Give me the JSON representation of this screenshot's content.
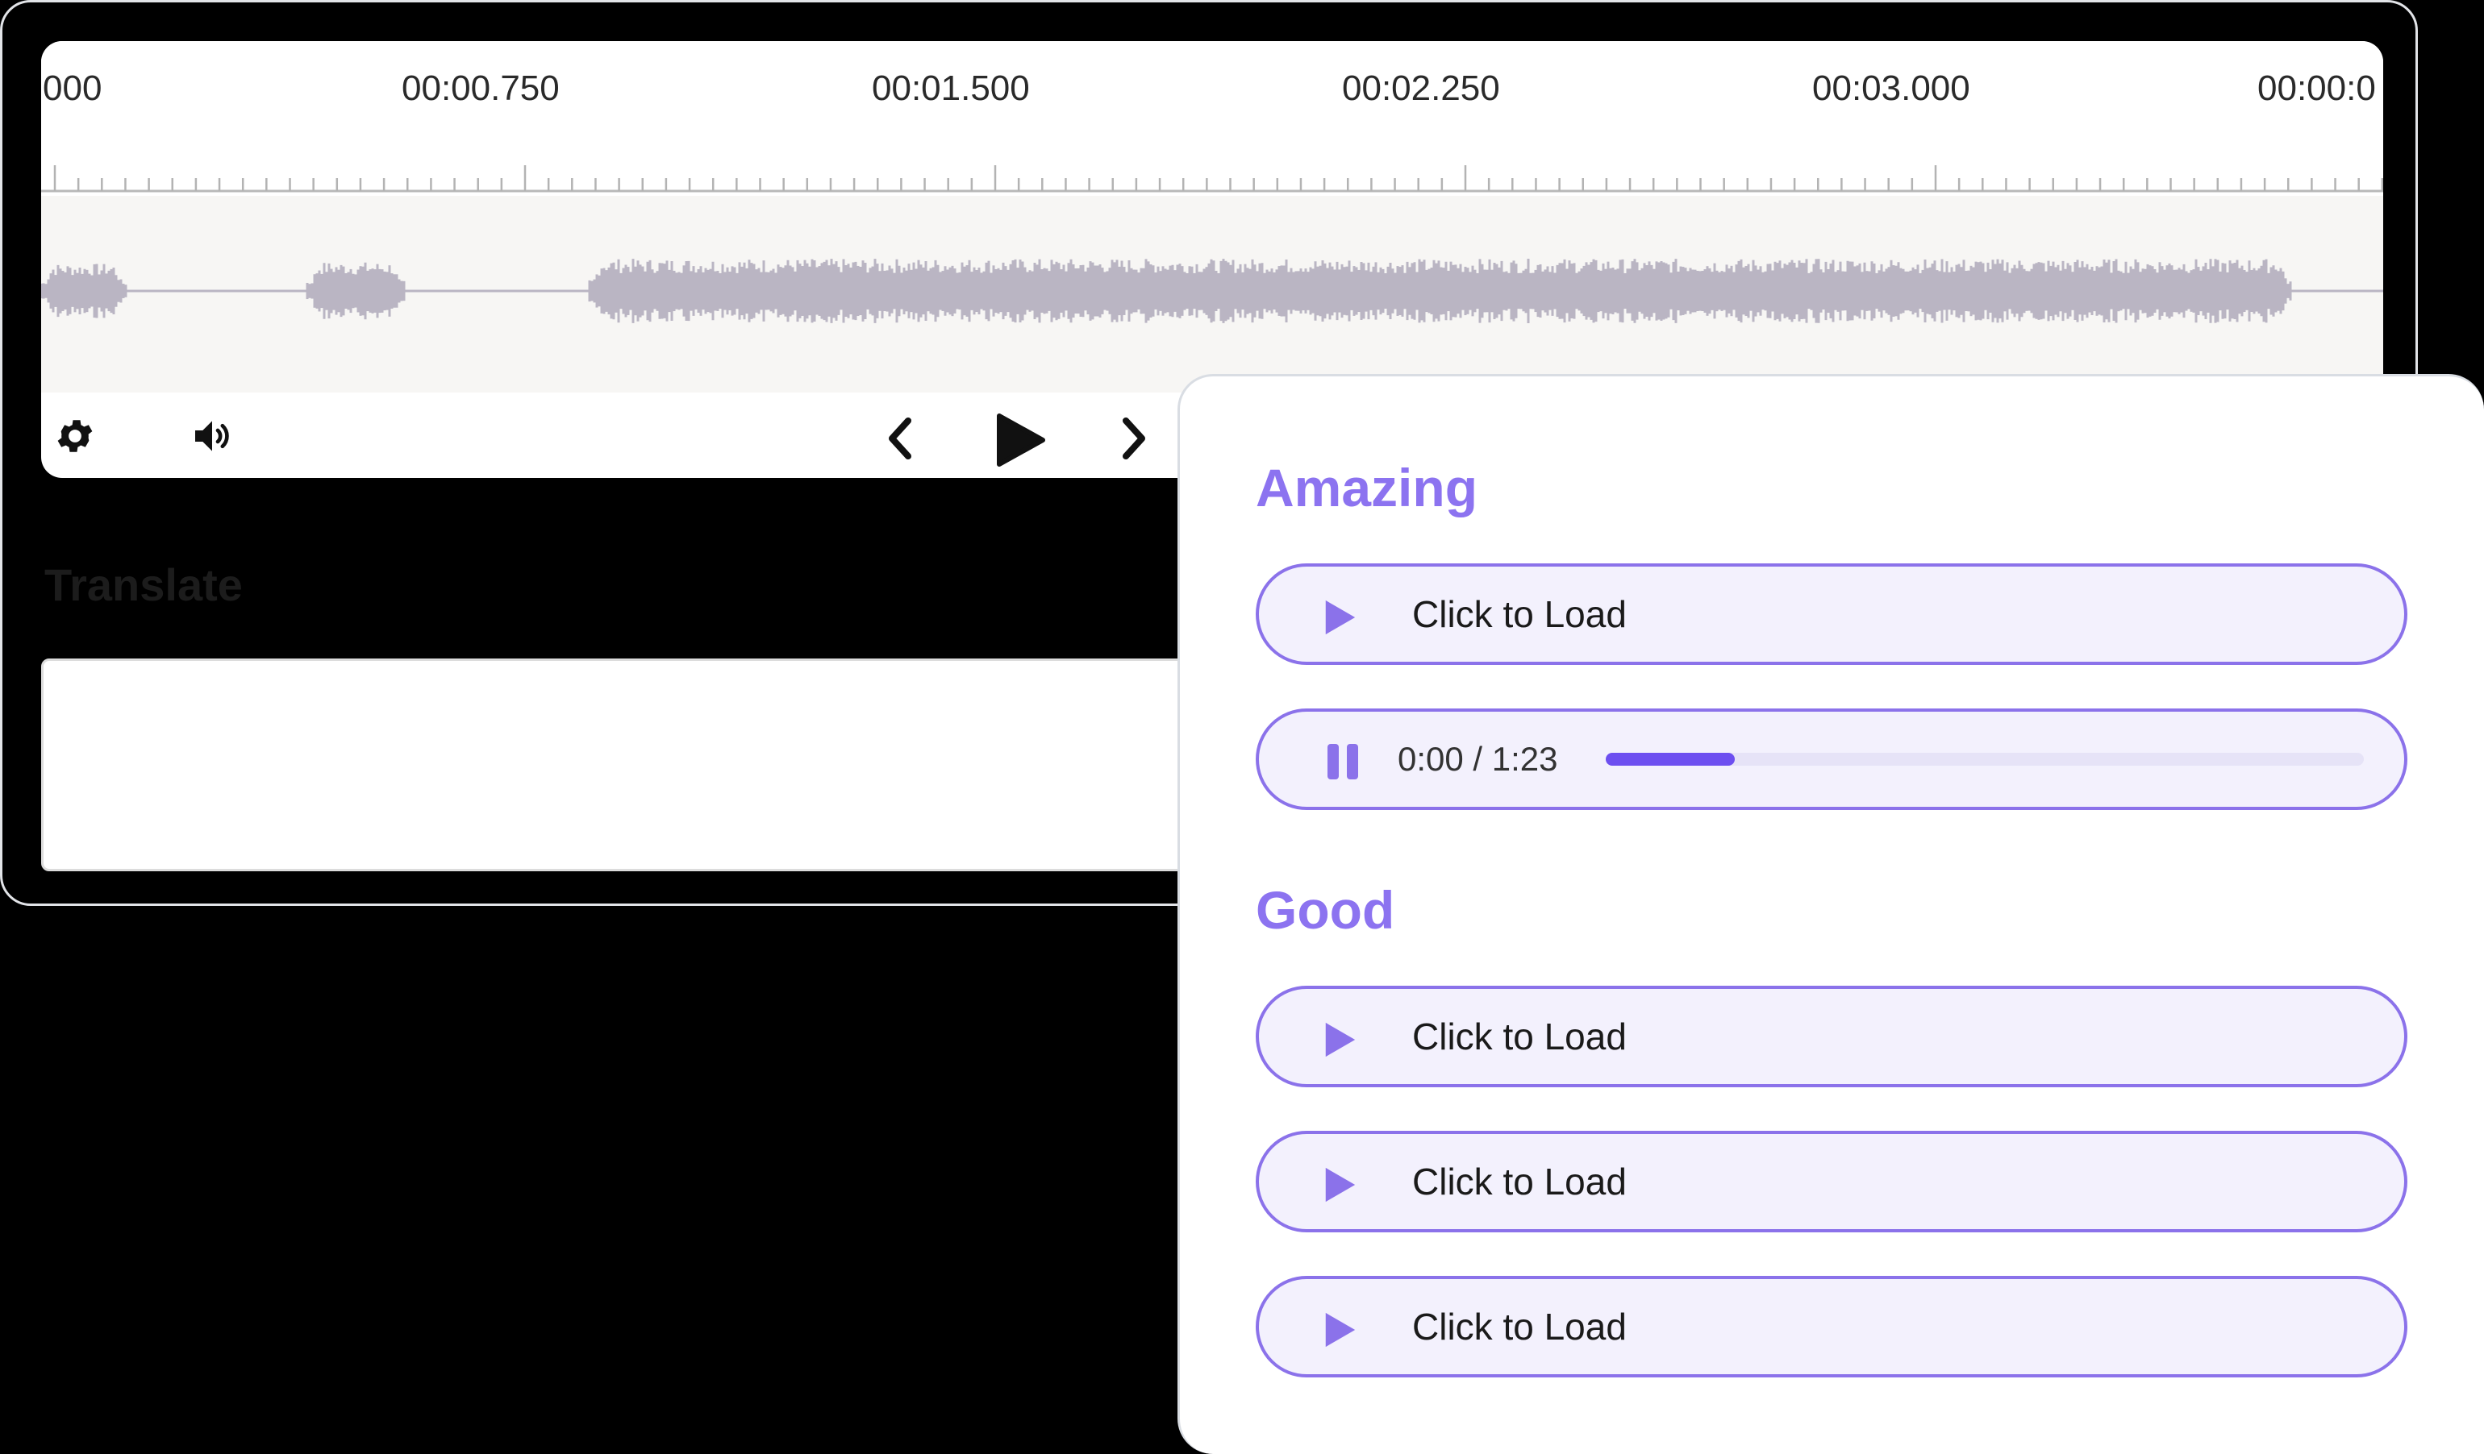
{
  "timeline": {
    "ticks": [
      "000",
      "00:00.750",
      "00:01.500",
      "00:02.250",
      "00:03.000",
      "00:00:0"
    ]
  },
  "controls": {
    "settings": "gear-icon",
    "volume": "speaker-icon",
    "previous": "chevron-left-icon",
    "play": "play-icon",
    "next": "chevron-right-icon"
  },
  "translate": {
    "label": "Translate",
    "value": ""
  },
  "panel": {
    "sections": [
      {
        "heading": "Amazing",
        "items": [
          {
            "state": "idle",
            "label": "Click to Load"
          },
          {
            "state": "playing",
            "time": "0:00 / 1:23",
            "progress": 0.17
          }
        ]
      },
      {
        "heading": "Good",
        "items": [
          {
            "state": "idle",
            "label": "Click to Load"
          },
          {
            "state": "idle",
            "label": "Click to Load"
          },
          {
            "state": "idle",
            "label": "Click to Load"
          }
        ]
      }
    ]
  },
  "colors": {
    "accent": "#8c73f0",
    "accent_dark": "#6d4ff0",
    "pill_bg": "#f3f1fd",
    "waveform": "#bab5c3"
  }
}
